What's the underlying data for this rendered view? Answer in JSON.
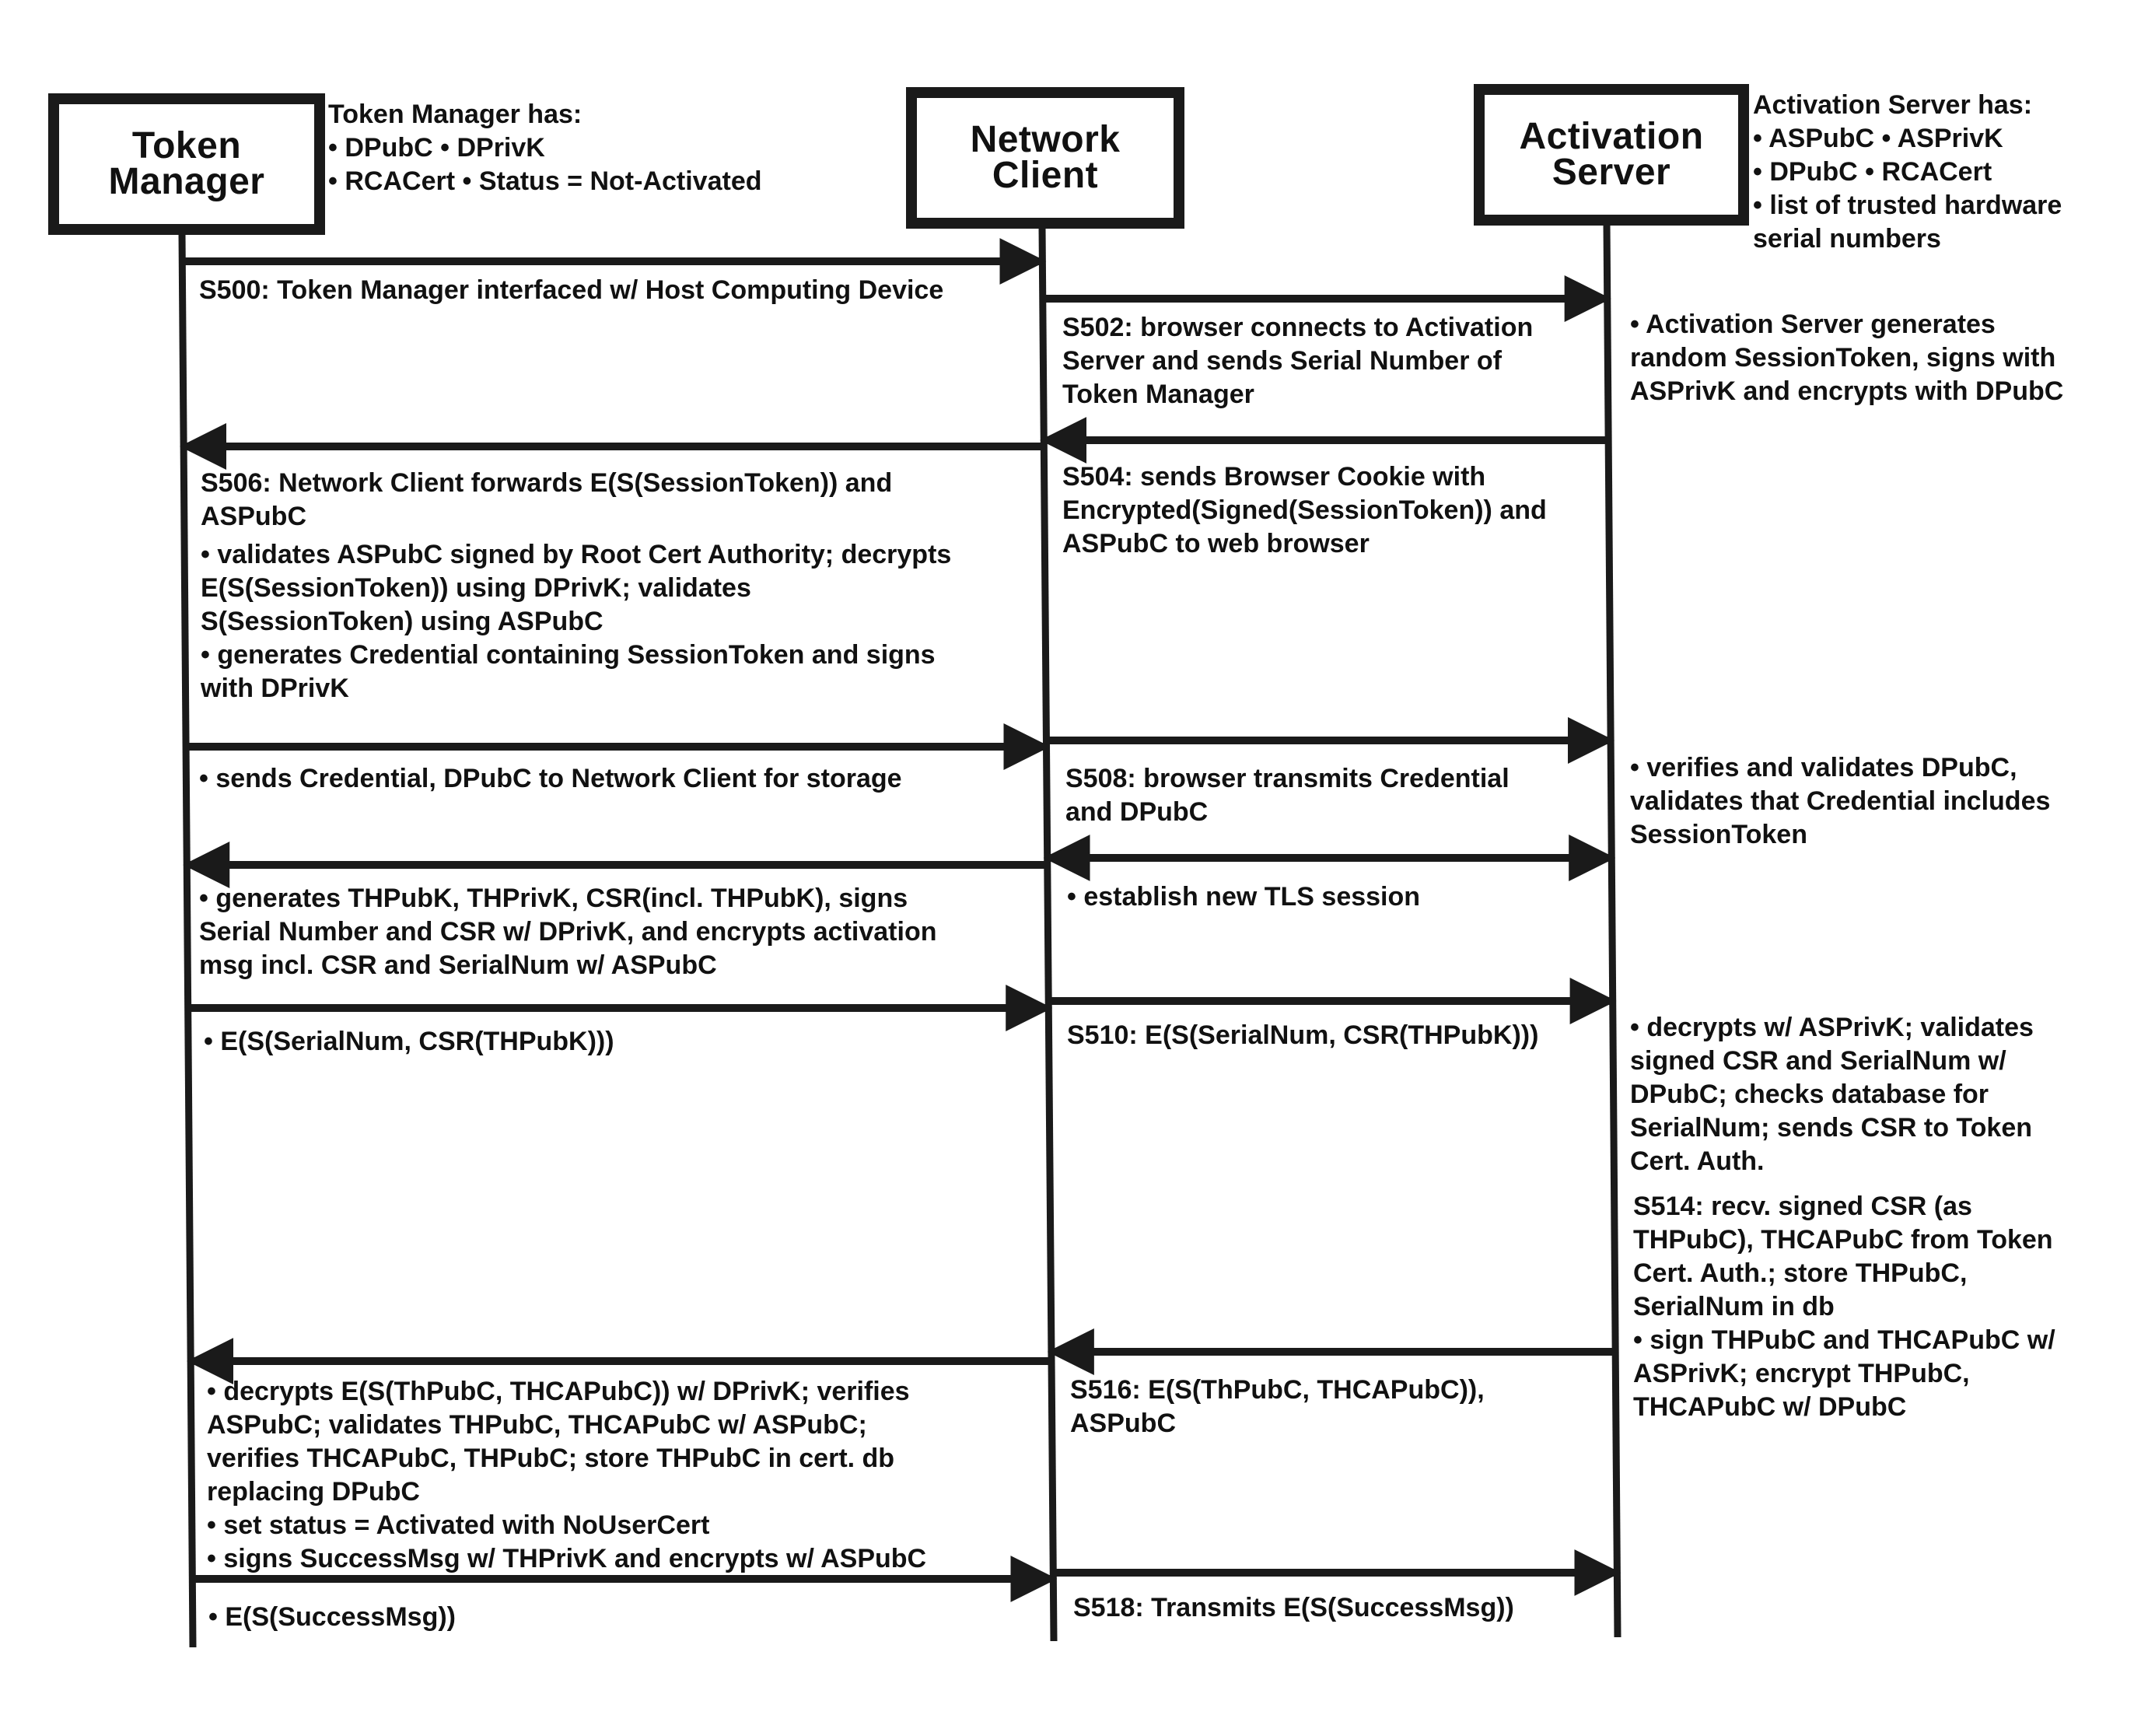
{
  "actors": {
    "token_manager": {
      "lines": [
        "Token",
        "Manager"
      ]
    },
    "network_client": {
      "lines": [
        "Network",
        "Client"
      ]
    },
    "activation_server": {
      "lines": [
        "Activation",
        "Server"
      ]
    }
  },
  "notes": {
    "token_manager_has": [
      "Token Manager has:",
      "• DPubC  • DPrivK",
      "• RCACert  • Status = Not-Activated"
    ],
    "activation_server_has": [
      "Activation Server has:",
      "• ASPubC  • ASPrivK",
      "• DPubC  • RCACert",
      "• list of trusted hardware",
      "serial numbers"
    ],
    "as_generates_token": [
      "• Activation Server generates",
      "random SessionToken, signs with",
      "ASPrivK and encrypts with DPubC"
    ],
    "as_verifies": [
      "• verifies and validates DPubC,",
      "validates that Credential includes",
      "SessionToken"
    ],
    "as_decrypts": [
      "• decrypts w/ ASPrivK; validates",
      "signed CSR and SerialNum w/",
      "DPubC; checks database for",
      "SerialNum; sends CSR to Token",
      "Cert. Auth."
    ],
    "as_s514": [
      "S514: recv. signed CSR (as",
      "THPubC), THCAPubC from Token",
      "Cert. Auth.; store THPubC,",
      "SerialNum in db",
      "• sign THPubC and THCAPubC w/",
      "ASPrivK; encrypt THPubC,",
      "THCAPubC w/ DPubC"
    ]
  },
  "messages": {
    "s500": [
      "S500: Token Manager interfaced w/ Host Computing Device"
    ],
    "s502": [
      "S502: browser connects to Activation",
      "Server and sends Serial Number of",
      "Token Manager"
    ],
    "s504": [
      "S504: sends Browser Cookie with",
      "Encrypted(Signed(SessionToken)) and",
      "ASPubC to web browser"
    ],
    "s506": [
      "S506: Network Client forwards E(S(SessionToken)) and",
      "ASPubC",
      "• validates ASPubC signed by Root Cert Authority; decrypts",
      "E(S(SessionToken)) using DPrivK; validates",
      "S(SessionToken) using ASPubC",
      "• generates Credential containing SessionToken and signs",
      "with DPrivK"
    ],
    "tm_sends_credential": [
      "• sends Credential, DPubC to Network Client for storage"
    ],
    "s508": [
      "S508: browser transmits Credential",
      "and DPubC"
    ],
    "tm_generates_keys": [
      "• generates THPubK, THPrivK, CSR(incl. THPubK), signs",
      "Serial Number and CSR w/ DPrivK, and encrypts activation",
      "msg incl. CSR and SerialNum w/ ASPubC"
    ],
    "tls": [
      "• establish new TLS session"
    ],
    "tm_activation_msg": [
      "• E(S(SerialNum, CSR(THPubK)))"
    ],
    "s510": [
      "S510: E(S(SerialNum, CSR(THPubK)))"
    ],
    "tm_decrypts": [
      "• decrypts E(S(ThPubC, THCAPubC)) w/ DPrivK; verifies",
      "ASPubC; validates THPubC, THCAPubC w/ ASPubC;",
      "verifies THCAPubC, THPubC; store THPubC in cert. db",
      "replacing DPubC",
      "• set status = Activated with NoUserCert",
      "• signs SuccessMsg w/ THPrivK and encrypts w/ ASPubC"
    ],
    "s516": [
      "S516: E(S(ThPubC, THCAPubC)),",
      "ASPubC"
    ],
    "tm_success": [
      "• E(S(SuccessMsg))"
    ],
    "s518": [
      "S518: Transmits E(S(SuccessMsg))"
    ]
  },
  "arrows": [
    {
      "name": "s500-arrow",
      "from": "token_manager",
      "to": "network_client",
      "heads": "end"
    },
    {
      "name": "s502-arrow",
      "from": "network_client",
      "to": "activation_server",
      "heads": "end"
    },
    {
      "name": "s504-arrow",
      "from": "activation_server",
      "to": "network_client",
      "heads": "end"
    },
    {
      "name": "s506-arrow",
      "from": "network_client",
      "to": "token_manager",
      "heads": "end"
    },
    {
      "name": "credential-arrow",
      "from": "token_manager",
      "to": "network_client",
      "heads": "end"
    },
    {
      "name": "s508-arrow",
      "from": "network_client",
      "to": "activation_server",
      "heads": "end"
    },
    {
      "name": "tls-client-arrow",
      "from": "network_client",
      "to": "token_manager",
      "heads": "end"
    },
    {
      "name": "tls-server-arrow",
      "from": "network_client",
      "to": "activation_server",
      "heads": "both"
    },
    {
      "name": "activation-msg-arrow",
      "from": "token_manager",
      "to": "network_client",
      "heads": "end"
    },
    {
      "name": "s510-arrow",
      "from": "network_client",
      "to": "activation_server",
      "heads": "end"
    },
    {
      "name": "s516-arrow",
      "from": "activation_server",
      "to": "network_client",
      "heads": "end"
    },
    {
      "name": "cert-return-arrow",
      "from": "network_client",
      "to": "token_manager",
      "heads": "end"
    },
    {
      "name": "success-msg-arrow",
      "from": "token_manager",
      "to": "network_client",
      "heads": "end"
    },
    {
      "name": "s518-arrow",
      "from": "network_client",
      "to": "activation_server",
      "heads": "end"
    }
  ]
}
